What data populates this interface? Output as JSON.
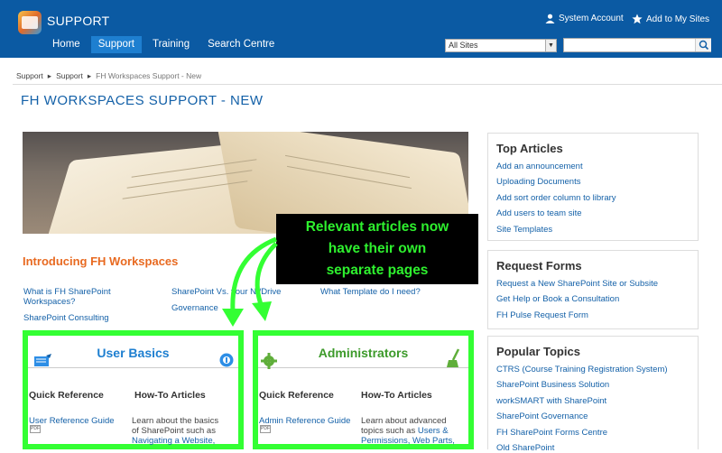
{
  "header": {
    "site_title": "SUPPORT",
    "system_account": "System Account",
    "add_to_my_sites": "Add to My Sites",
    "scope": "All Sites",
    "search_placeholder": ""
  },
  "nav": [
    {
      "label": "Home"
    },
    {
      "label": "Support"
    },
    {
      "label": "Training"
    },
    {
      "label": "Search Centre"
    }
  ],
  "breadcrumb": {
    "items": [
      "Support",
      "Support"
    ],
    "current": "FH Workspaces Support - New"
  },
  "page_title": "FH WORKSPACES SUPPORT - NEW",
  "intro": {
    "heading": "Introducing FH Workspaces",
    "links": [
      "What is FH SharePoint Workspaces?",
      "SharePoint Consulting",
      "SharePoint Vs. your N:/Drive",
      "Governance",
      "What Template do I need?"
    ]
  },
  "callout": {
    "line1": "Relevant articles now",
    "line2": "have their own",
    "line3": "separate pages"
  },
  "user_basics": {
    "title": "User Basics",
    "quick_ref": "Quick Reference",
    "howto": "How-To Articles",
    "guide": "User Reference Guide",
    "desc1": "Learn about the basics",
    "desc2": "of SharePoint such as",
    "desc3": "Navigating a Website,",
    "pdf": "PDF"
  },
  "administrators": {
    "title": "Administrators",
    "quick_ref": "Quick Reference",
    "howto": "How-To Articles",
    "guide": "Admin Reference Guide",
    "desc1": "Learn about advanced",
    "desc2": "topics such as",
    "desc2_link": "Users &",
    "desc3": "Permissions, Web Parts,",
    "pdf": "PDF"
  },
  "top_articles": {
    "title": "Top Articles",
    "items": [
      "Add an announcement",
      "Uploading Documents",
      "Add sort order column to library",
      "Add users to team site",
      "Site Templates"
    ]
  },
  "request_forms": {
    "title": "Request Forms",
    "items": [
      "Request a New SharePoint Site or Subsite",
      "Get Help or Book a Consultation",
      "FH Pulse Request Form"
    ]
  },
  "popular_topics": {
    "title": "Popular Topics",
    "items": [
      "CTRS (Course Training Registration System)",
      "SharePoint Business Solution",
      "workSMART with SharePoint",
      "SharePoint Governance",
      "FH SharePoint Forms Centre",
      "Old SharePoint"
    ]
  },
  "colors": {
    "header_bg": "#0b5aa3",
    "nav_active": "#1e7fd0",
    "title_blue": "#1461a8",
    "intro_orange": "#e86a21",
    "highlight_green": "#33ff33",
    "admin_green": "#3c9a2a"
  }
}
